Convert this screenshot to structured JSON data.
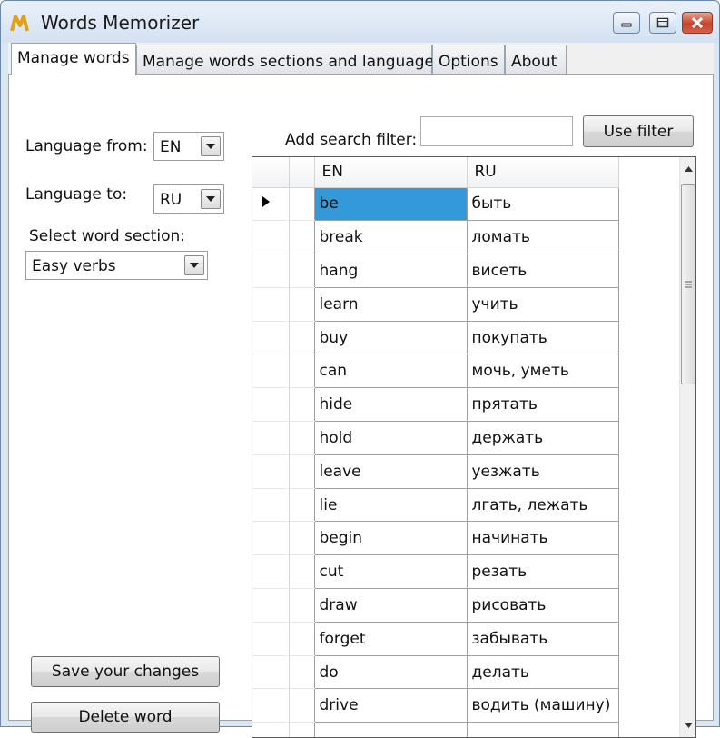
{
  "window": {
    "title": "Words Memorizer",
    "icon": "app-logo-icon",
    "controls": [
      "minimize-icon",
      "maximize-icon",
      "close-icon"
    ]
  },
  "tabs": [
    {
      "label": "Manage words",
      "active": true
    },
    {
      "label": "Manage words sections and languages",
      "active": false
    },
    {
      "label": "Options",
      "active": false
    },
    {
      "label": "About",
      "active": false
    }
  ],
  "form": {
    "language_from_label": "Language from:",
    "language_from_value": "EN",
    "language_to_label": "Language to:",
    "language_to_value": "RU",
    "section_label": "Select word section:",
    "section_value": "Easy verbs"
  },
  "search": {
    "label": "Add search filter:",
    "value": "",
    "button": "Use filter"
  },
  "actions": {
    "save": "Save your changes",
    "delete": "Delete word"
  },
  "table": {
    "columns": [
      "EN",
      "RU"
    ],
    "selected_index": 0,
    "rows": [
      {
        "en": "be",
        "ru": "быть"
      },
      {
        "en": "break",
        "ru": "ломать"
      },
      {
        "en": "hang",
        "ru": "висеть"
      },
      {
        "en": "learn",
        "ru": "учить"
      },
      {
        "en": "buy",
        "ru": "покупать"
      },
      {
        "en": "can",
        "ru": "мочь, уметь"
      },
      {
        "en": "hide",
        "ru": "прятать"
      },
      {
        "en": "hold",
        "ru": "держать"
      },
      {
        "en": "leave",
        "ru": "уезжать"
      },
      {
        "en": "lie",
        "ru": "лгать, лежать"
      },
      {
        "en": "begin",
        "ru": "начинать"
      },
      {
        "en": "cut",
        "ru": "резать"
      },
      {
        "en": "draw",
        "ru": "рисовать"
      },
      {
        "en": "forget",
        "ru": "забывать"
      },
      {
        "en": "do",
        "ru": "делать"
      },
      {
        "en": "drive",
        "ru": "водить (машину)"
      },
      {
        "en": "",
        "ru": ""
      }
    ]
  },
  "colors": {
    "selection": "#3399d9",
    "titlebar": "#d4e1f1",
    "close_button": "#c5442c"
  }
}
